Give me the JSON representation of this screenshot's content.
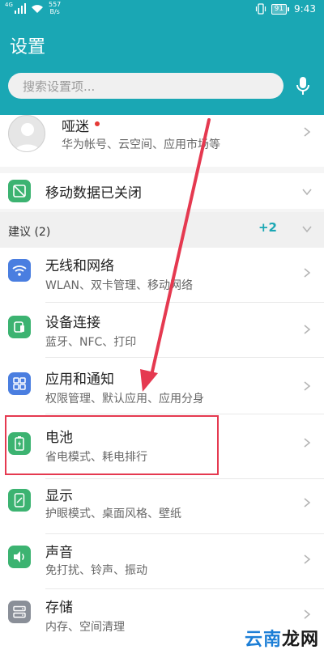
{
  "status_bar": {
    "network_type": "4G",
    "speed_value": "557",
    "speed_unit": "B/s",
    "battery": "91",
    "time": "9:43"
  },
  "header": {
    "title": "设置"
  },
  "search": {
    "placeholder": "搜索设置项..."
  },
  "profile": {
    "name": "哑迷",
    "subtitle": "华为帐号、云空间、应用市场等"
  },
  "mobile_data": {
    "label": "移动数据已关闭"
  },
  "suggestions": {
    "label": "建议 (2)",
    "count": "+2"
  },
  "items": [
    {
      "title": "无线和网络",
      "subtitle": "WLAN、双卡管理、移动网络",
      "icon": "wifi-icon",
      "color": "#4a7ee0"
    },
    {
      "title": "设备连接",
      "subtitle": "蓝牙、NFC、打印",
      "icon": "device-connect-icon",
      "color": "#3cb371"
    },
    {
      "title": "应用和通知",
      "subtitle": "权限管理、默认应用、应用分身",
      "icon": "apps-grid-icon",
      "color": "#4a7ee0"
    },
    {
      "title": "电池",
      "subtitle": "省电模式、耗电排行",
      "icon": "battery-icon",
      "color": "#3cb371"
    },
    {
      "title": "显示",
      "subtitle": "护眼模式、桌面风格、壁纸",
      "icon": "display-icon",
      "color": "#3cb371"
    },
    {
      "title": "声音",
      "subtitle": "免打扰、铃声、振动",
      "icon": "sound-icon",
      "color": "#3cb371"
    },
    {
      "title": "存储",
      "subtitle": "内存、空间清理",
      "icon": "storage-icon",
      "color": "#8a8f98"
    }
  ],
  "watermark": {
    "part1": "云南",
    "part2": "龙网"
  },
  "colors": {
    "accent": "#1aa7b4",
    "highlight": "#e53950",
    "arrow": "#e53950"
  }
}
